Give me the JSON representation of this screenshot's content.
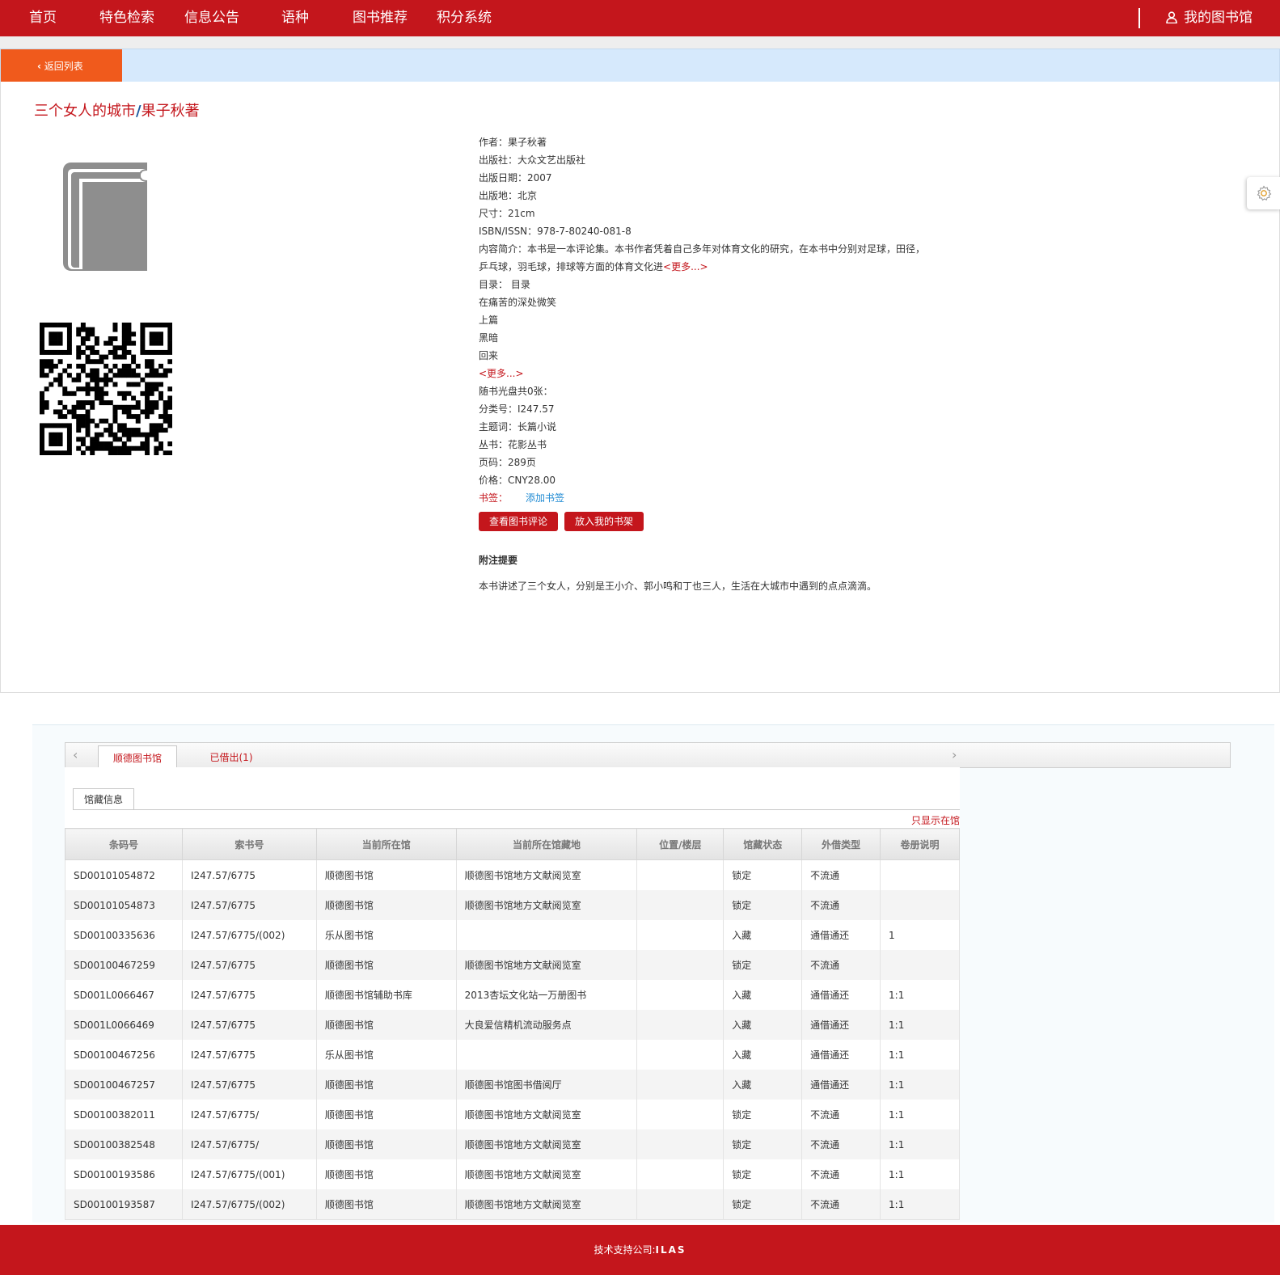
{
  "nav": {
    "items": [
      "首页",
      "特色检索",
      "信息公告",
      "语种",
      "图书推荐",
      "积分系统"
    ],
    "my_library": "我的图书馆"
  },
  "back": {
    "label": "返回列表"
  },
  "book": {
    "title": "三个女人的城市",
    "slash": "/",
    "responsibility": "果子秋著",
    "fields": {
      "author": "作者：果子秋著",
      "publisher": "出版社：大众文艺出版社",
      "pub_date": "出版日期：2007",
      "pub_place": "出版地：北京",
      "size": "尺寸：21cm",
      "isbn": "ISBN/ISSN：978-7-80240-081-8",
      "summary": "内容简介：本书是一本评论集。本书作者凭着自己多年对体育文化的研究，在本书中分别对足球，田径，乒乓球，羽毛球，排球等方面的体育文化进",
      "summary_more": "<更多...>",
      "toc_label": "目录：  目录",
      "toc_items": [
        "在痛苦的深处微笑",
        "上篇",
        "黑暗",
        "回来"
      ],
      "toc_more": "<更多...>",
      "cd": "随书光盘共0张：",
      "class_no": "分类号：I247.57",
      "subject": "主题词：长篇小说",
      "series": "丛书：花影丛书",
      "pages": "页码：289页",
      "price": "价格：CNY28.00",
      "bookmark_label": "书签：",
      "bookmark_add": "添加书签"
    },
    "buttons": {
      "reviews": "查看图书评论",
      "shelf": "放入我的书架"
    },
    "notes_title": "附注提要",
    "notes_text": "本书讲述了三个女人，分别是王小介、郭小鸣和丁也三人，生活在大城市中遇到的点点滴滴。"
  },
  "holdings": {
    "tabs": [
      "顺德图书馆",
      "已借出(1)"
    ],
    "subtab": "馆藏信息",
    "only_show": "只显示在馆",
    "columns": [
      "条码号",
      "索书号",
      "当前所在馆",
      "当前所在馆藏地",
      "位置/楼层",
      "馆藏状态",
      "外借类型",
      "卷册说明"
    ],
    "rows": [
      [
        "SD00101054872",
        "I247.57/6775",
        "顺德图书馆",
        "顺德图书馆地方文献阅览室",
        "",
        "锁定",
        "不流通",
        ""
      ],
      [
        "SD00101054873",
        "I247.57/6775",
        "顺德图书馆",
        "顺德图书馆地方文献阅览室",
        "",
        "锁定",
        "不流通",
        ""
      ],
      [
        "SD00100335636",
        "I247.57/6775/(002)",
        "乐从图书馆",
        "",
        "",
        "入藏",
        "通借通还",
        "1"
      ],
      [
        "SD00100467259",
        "I247.57/6775",
        "顺德图书馆",
        "顺德图书馆地方文献阅览室",
        "",
        "锁定",
        "不流通",
        ""
      ],
      [
        "SD001L0066467",
        "I247.57/6775",
        "顺德图书馆辅助书库",
        "2013杏坛文化站一万册图书",
        "",
        "入藏",
        "通借通还",
        "1:1"
      ],
      [
        "SD001L0066469",
        "I247.57/6775",
        "顺德图书馆",
        "大良爱信精机流动服务点",
        "",
        "入藏",
        "通借通还",
        "1:1"
      ],
      [
        "SD00100467256",
        "I247.57/6775",
        "乐从图书馆",
        "",
        "",
        "入藏",
        "通借通还",
        "1:1"
      ],
      [
        "SD00100467257",
        "I247.57/6775",
        "顺德图书馆",
        "顺德图书馆图书借阅厅",
        "",
        "入藏",
        "通借通还",
        "1:1"
      ],
      [
        "SD00100382011",
        "I247.57/6775/",
        "顺德图书馆",
        "顺德图书馆地方文献阅览室",
        "",
        "锁定",
        "不流通",
        "1:1"
      ],
      [
        "SD00100382548",
        "I247.57/6775/",
        "顺德图书馆",
        "顺德图书馆地方文献阅览室",
        "",
        "锁定",
        "不流通",
        "1:1"
      ],
      [
        "SD00100193586",
        "I247.57/6775/(001)",
        "顺德图书馆",
        "顺德图书馆地方文献阅览室",
        "",
        "锁定",
        "不流通",
        "1:1"
      ],
      [
        "SD00100193587",
        "I247.57/6775/(002)",
        "顺德图书馆",
        "顺德图书馆地方文献阅览室",
        "",
        "锁定",
        "不流通",
        "1:1"
      ]
    ]
  },
  "footer": {
    "label": "技术支持公司:",
    "company": "ILAS"
  },
  "colors": {
    "brand_red": "#c4161c",
    "back_orange": "#f05a1c",
    "back_bar": "#d6e9fc"
  }
}
